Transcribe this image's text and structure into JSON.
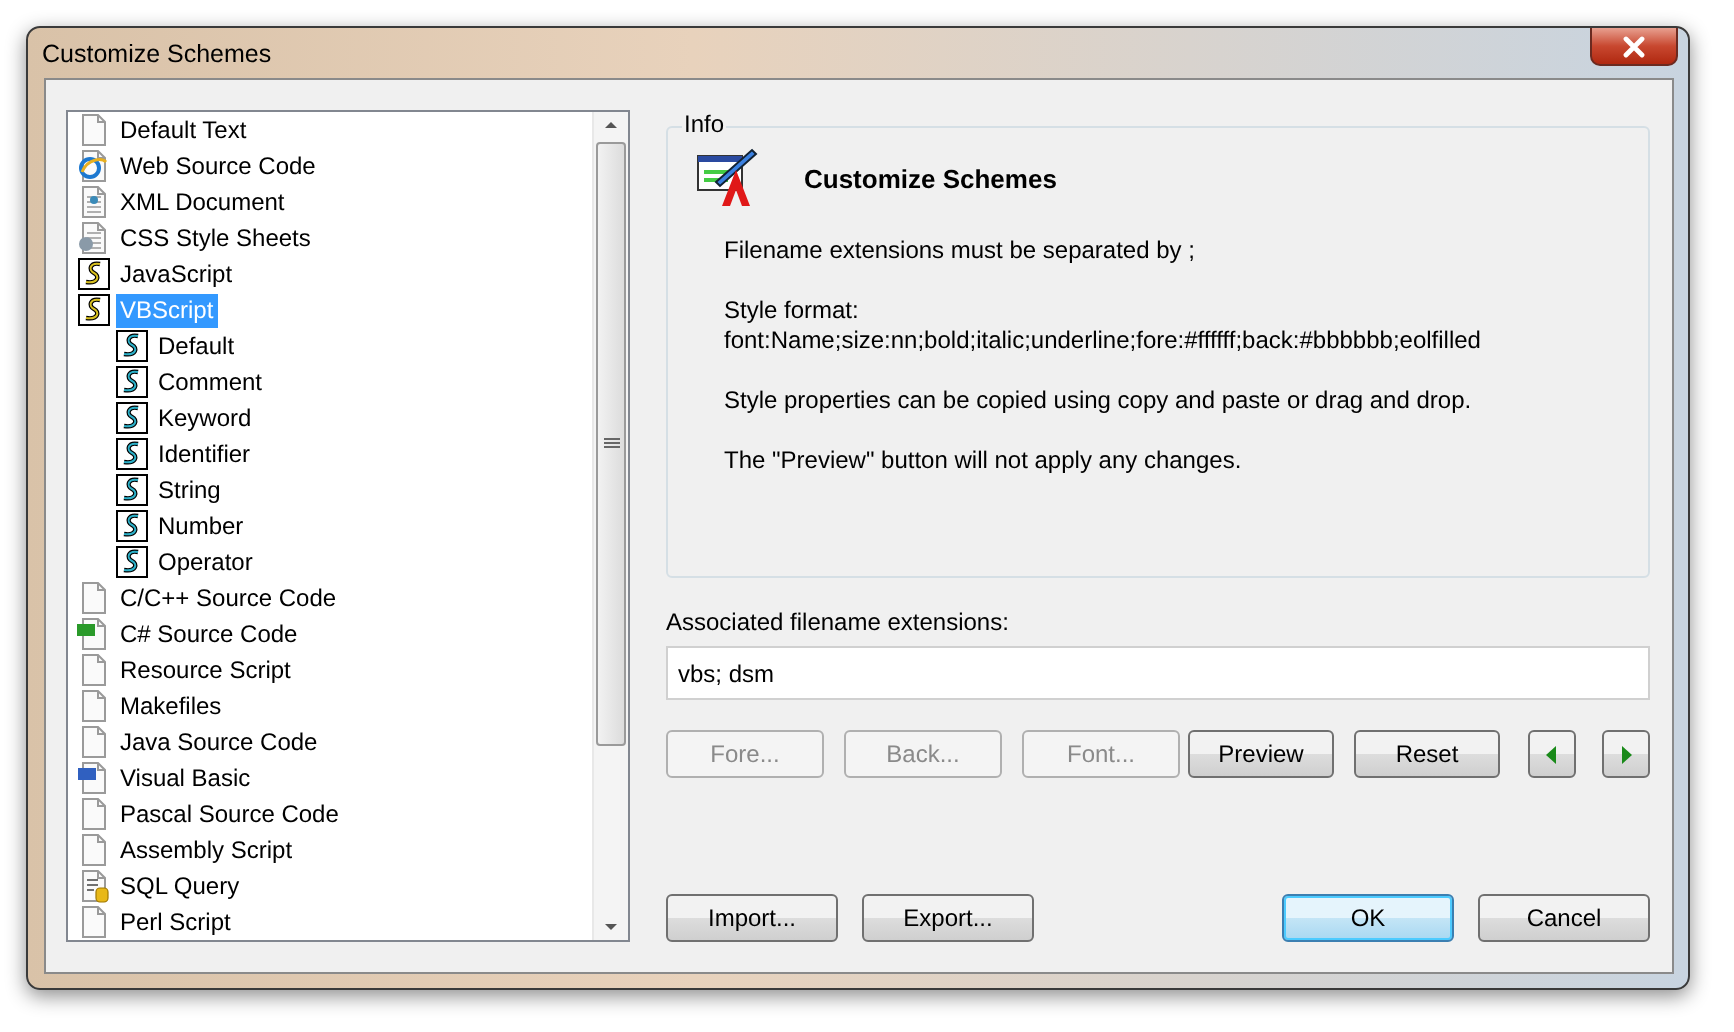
{
  "window": {
    "title": "Customize Schemes"
  },
  "tree": {
    "items": [
      {
        "label": "Default Text",
        "kind": "doc",
        "selected": false
      },
      {
        "label": "Web Source Code",
        "kind": "web",
        "selected": false
      },
      {
        "label": "XML Document",
        "kind": "xml",
        "selected": false
      },
      {
        "label": "CSS Style Sheets",
        "kind": "css",
        "selected": false
      },
      {
        "label": "JavaScript",
        "kind": "script",
        "selected": false
      },
      {
        "label": "VBScript",
        "kind": "script",
        "selected": true,
        "children": [
          {
            "label": "Default",
            "kind": "script",
            "selected": false
          },
          {
            "label": "Comment",
            "kind": "script",
            "selected": false
          },
          {
            "label": "Keyword",
            "kind": "script",
            "selected": false
          },
          {
            "label": "Identifier",
            "kind": "script",
            "selected": false
          },
          {
            "label": "String",
            "kind": "script",
            "selected": false
          },
          {
            "label": "Number",
            "kind": "script",
            "selected": false
          },
          {
            "label": "Operator",
            "kind": "script",
            "selected": false
          }
        ]
      },
      {
        "label": "C/C++ Source Code",
        "kind": "doc",
        "selected": false
      },
      {
        "label": "C# Source Code",
        "kind": "cs",
        "selected": false
      },
      {
        "label": "Resource Script",
        "kind": "doc",
        "selected": false
      },
      {
        "label": "Makefiles",
        "kind": "doc",
        "selected": false
      },
      {
        "label": "Java Source Code",
        "kind": "doc",
        "selected": false
      },
      {
        "label": "Visual Basic",
        "kind": "vb",
        "selected": false
      },
      {
        "label": "Pascal Source Code",
        "kind": "doc",
        "selected": false
      },
      {
        "label": "Assembly Script",
        "kind": "doc",
        "selected": false
      },
      {
        "label": "SQL Query",
        "kind": "sql",
        "selected": false
      },
      {
        "label": "Perl Script",
        "kind": "doc",
        "selected": false
      }
    ]
  },
  "info": {
    "label": "Info",
    "heading": "Customize Schemes",
    "paragraphs": [
      [
        "Filename extensions must be separated by ;"
      ],
      [
        "Style format:",
        "font:Name;size:nn;bold;italic;underline;fore:#ffffff;back:#bbbbbb;eolfilled"
      ],
      [
        "Style properties can be copied using copy and paste or drag and drop."
      ],
      [
        "The \"Preview\" button will not apply any changes."
      ]
    ]
  },
  "extensions": {
    "label": "Associated filename extensions:",
    "value": "vbs; dsm"
  },
  "style_buttons": [
    {
      "kind": "text",
      "label": "Fore...",
      "disabled": true
    },
    {
      "kind": "text",
      "label": "Back...",
      "disabled": true
    },
    {
      "kind": "text",
      "label": "Font...",
      "disabled": true
    },
    {
      "kind": "text",
      "label": "Preview",
      "disabled": false
    },
    {
      "kind": "text",
      "label": "Reset",
      "disabled": false
    },
    {
      "kind": "left",
      "disabled": false
    },
    {
      "kind": "right",
      "disabled": false
    }
  ],
  "bottom_buttons": [
    {
      "label": "Import...",
      "default": false
    },
    {
      "label": "Export...",
      "default": false
    },
    {
      "label": "OK",
      "default": true
    },
    {
      "label": "Cancel",
      "default": false
    }
  ]
}
